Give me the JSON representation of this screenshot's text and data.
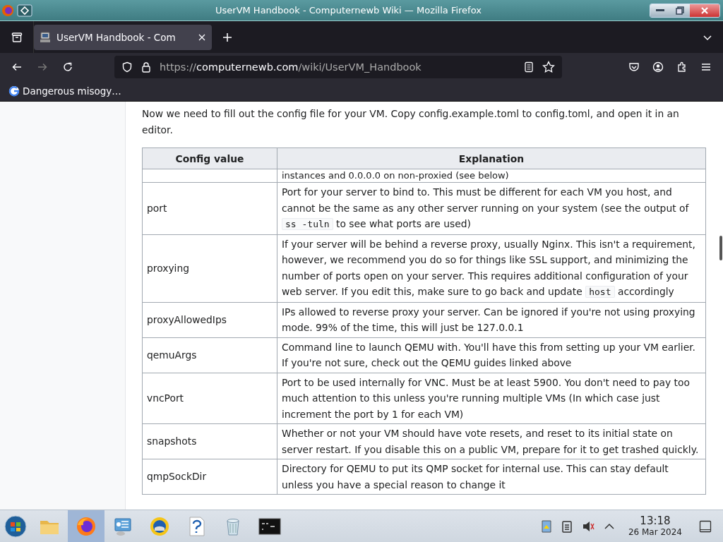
{
  "window": {
    "title": "UserVM Handbook - Computernewb Wiki — Mozilla Firefox"
  },
  "tabs": [
    {
      "label": "UserVM Handbook - Com",
      "selected": true
    }
  ],
  "address_bar": {
    "scheme": "https://",
    "domain": "computernewb.com",
    "path": "/wiki/UserVM_Handbook"
  },
  "bookmarks": [
    {
      "label": "Dangerous misogy…"
    }
  ],
  "article": {
    "intro": "Now we need to fill out the config file for your VM. Copy config.example.toml to config.toml, and open it in an editor.",
    "table": {
      "columns": [
        "Config value",
        "Explanation"
      ],
      "rows": [
        {
          "explanation": [
            {
              "kind": "text",
              "text": "instances and 0.0.0.0 on non-proxied (see below)"
            }
          ]
        },
        {
          "name": "port",
          "explanation": [
            {
              "kind": "text",
              "text": "Port for your server to bind to. This must be different for each VM you host, and cannot be the same as any other server running on your system (see the output of "
            },
            {
              "kind": "code",
              "text": "ss -tuln"
            },
            {
              "kind": "text",
              "text": " to see what ports are used)"
            }
          ]
        },
        {
          "name": "proxying",
          "explanation": [
            {
              "kind": "text",
              "text": "If your server will be behind a reverse proxy, usually Nginx. This isn't a requirement, however, we recommend you do so for things like SSL support, and minimizing the number of ports open on your server. This requires additional configuration of your web server. If you edit this, make sure to go back and update "
            },
            {
              "kind": "code",
              "text": "host"
            },
            {
              "kind": "text",
              "text": " accordingly"
            }
          ]
        },
        {
          "name": "proxyAllowedIps",
          "explanation": [
            {
              "kind": "text",
              "text": "IPs allowed to reverse proxy your server. Can be ignored if you're not using proxying mode. 99% of the time, this will just be 127.0.0.1"
            }
          ]
        },
        {
          "name": "qemuArgs",
          "explanation": [
            {
              "kind": "text",
              "text": "Command line to launch QEMU with. You'll have this from setting up your VM earlier. If you're not sure, check out the QEMU guides linked above"
            }
          ]
        },
        {
          "name": "vncPort",
          "explanation": [
            {
              "kind": "text",
              "text": "Port to be used internally for VNC. Must be at least 5900. You don't need to pay too much attention to this unless you're running multiple VMs (In which case just increment the port by 1 for each VM)"
            }
          ]
        },
        {
          "name": "snapshots",
          "explanation": [
            {
              "kind": "text",
              "text": "Whether or not your VM should have vote resets, and reset to its initial state on server restart. If you disable this on a public VM, prepare for it to get trashed quickly."
            }
          ]
        },
        {
          "name": "qmpSockDir",
          "explanation": [
            {
              "kind": "text",
              "text": "Directory for QEMU to put its QMP socket for internal use. This can stay default unless you have a special reason to change it"
            }
          ]
        }
      ]
    }
  },
  "taskbar": {
    "apps": [
      {
        "kind": "folder",
        "selected": false
      },
      {
        "kind": "firefox",
        "selected": true
      },
      {
        "kind": "monitor",
        "selected": false
      },
      {
        "kind": "sun",
        "selected": false
      },
      {
        "kind": "help",
        "selected": false
      },
      {
        "kind": "trash",
        "selected": false
      },
      {
        "kind": "terminal",
        "selected": false
      }
    ],
    "time": "13:18",
    "date": "26 Mar 2024"
  }
}
